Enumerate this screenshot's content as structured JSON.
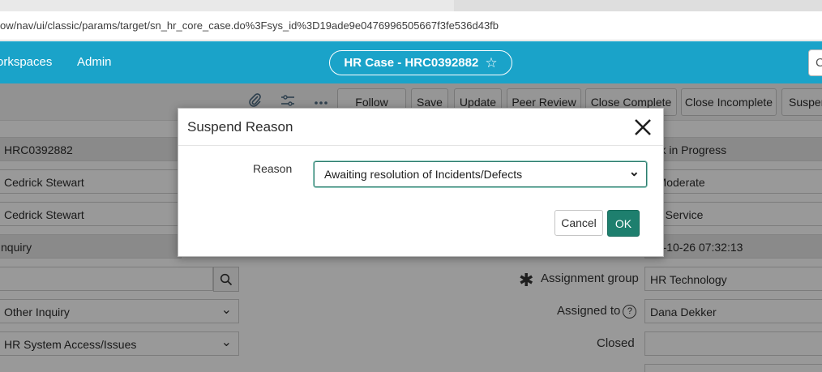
{
  "browser": {
    "url": "ow/nav/ui/classic/params/target/sn_hr_core_case.do%3Fsys_id%3D19ade9e0476996505667f3fe536d43fb"
  },
  "header": {
    "nav": [
      "orkspaces",
      "Admin"
    ],
    "case_title": "HR Case - HRC0392882",
    "star_icon": "star-outline-icon",
    "search_stub": "C"
  },
  "toolbar": {
    "icons": [
      "paperclip-icon",
      "sliders-icon",
      "more-icon"
    ],
    "buttons": [
      "Follow",
      "Save",
      "Update",
      "Peer Review",
      "Close Complete",
      "Close Incomplete",
      "Suspen"
    ]
  },
  "form": {
    "left_fields": [
      "HRC0392882",
      "Cedrick Stewart",
      "Cedrick Stewart",
      "nquiry",
      "",
      "Other Inquiry",
      "HR System Access/Issues"
    ],
    "right_fields": [
      "ork in Progress",
      "- Moderate",
      "elf Service",
      "24-10-26 07:32:13",
      "HR Technology",
      "Dana Dekker",
      ""
    ],
    "labels": {
      "assignment_group": "Assignment group",
      "assigned_to": "Assigned to",
      "closed": "Closed",
      "help": "?"
    }
  },
  "modal": {
    "title": "Suspend Reason",
    "reason_label": "Reason",
    "reason_value": "Awaiting resolution of Incidents/Defects",
    "cancel_label": "Cancel",
    "ok_label": "OK"
  },
  "colors": {
    "header_bg": "#1aa3c9",
    "ok_button": "#1e7f6e",
    "select_focus": "#2b7a6c"
  }
}
